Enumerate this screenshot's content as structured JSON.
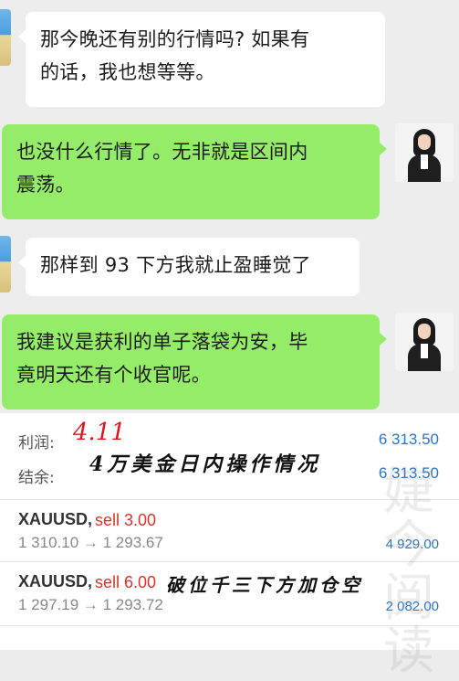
{
  "chat": {
    "messages": [
      {
        "side": "left",
        "line1": "那今晚还有别的行情吗? 如果有",
        "line2": "的话，我也想等等。"
      },
      {
        "side": "right",
        "line1": "也没什么行情了。无非就是区间内",
        "line2": "震荡。"
      },
      {
        "side": "left",
        "line1": "那样到 93 下方我就止盈睡觉了"
      },
      {
        "side": "right",
        "line1": "我建议是获利的单子落袋为安，毕",
        "line2": "竟明天还有个收官呢。"
      }
    ]
  },
  "account": {
    "profit_label": "利润:",
    "profit_value": "6 313.50",
    "balance_label": "结余:",
    "balance_value": "6 313.50"
  },
  "trades": [
    {
      "symbol": "XAUUSD,",
      "action": "sell 3.00",
      "prices": "1 310.10 → 1 293.67",
      "profit": "4 929.00"
    },
    {
      "symbol": "XAUUSD,",
      "action": "sell 6.00",
      "prices": "1 297.19 → 1 293.72",
      "profit": "2 082.00"
    }
  ],
  "annotations": {
    "date": "4.11",
    "summary": "4万美金日内操作情况",
    "trade_note": "破位千三下方加仓空"
  },
  "watermark": "婕今阅读",
  "colors": {
    "green_bubble": "#95ec69",
    "white_bubble": "#ffffff",
    "profit_blue": "#2a74c9",
    "sell_red": "#d9342b"
  }
}
